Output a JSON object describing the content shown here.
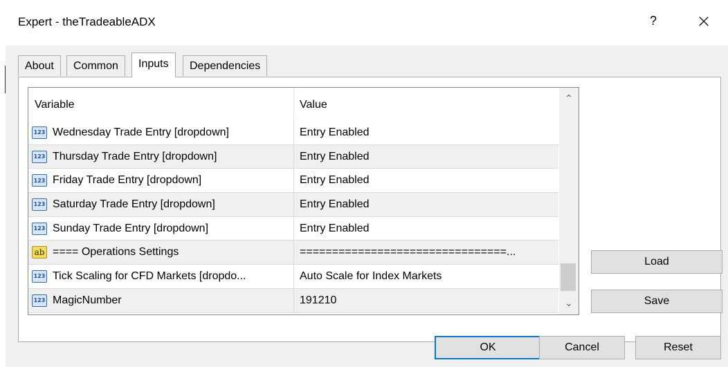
{
  "window": {
    "title": "Expert - theTradeableADX",
    "help_label": "?",
    "close_label": "×"
  },
  "tabs": [
    {
      "label": "About"
    },
    {
      "label": "Common"
    },
    {
      "label": "Inputs"
    },
    {
      "label": "Dependencies"
    }
  ],
  "active_tab": "Inputs",
  "grid": {
    "columns": {
      "variable": "Variable",
      "value": "Value"
    },
    "rows": [
      {
        "icon": "number-icon",
        "icon_text": "123",
        "variable": "Wednesday Trade Entry [dropdown]",
        "value": "Entry Enabled"
      },
      {
        "icon": "number-icon",
        "icon_text": "123",
        "variable": "Thursday Trade Entry [dropdown]",
        "value": "Entry Enabled"
      },
      {
        "icon": "number-icon",
        "icon_text": "123",
        "variable": "Friday Trade Entry [dropdown]",
        "value": "Entry Enabled"
      },
      {
        "icon": "number-icon",
        "icon_text": "123",
        "variable": "Saturday Trade Entry [dropdown]",
        "value": "Entry Enabled"
      },
      {
        "icon": "number-icon",
        "icon_text": "123",
        "variable": "Sunday Trade Entry [dropdown]",
        "value": "Entry Enabled"
      },
      {
        "icon": "string-icon",
        "icon_text": "ab",
        "variable": "==== Operations Settings",
        "value": "================================..."
      },
      {
        "icon": "number-icon",
        "icon_text": "123",
        "variable": "Tick Scaling for CFD Markets [dropdo...",
        "value": "Auto Scale for Index Markets"
      },
      {
        "icon": "number-icon",
        "icon_text": "123",
        "variable": "MagicNumber",
        "value": "191210"
      }
    ],
    "scroll_up": "⌃",
    "scroll_down": "⌄"
  },
  "side_buttons": {
    "load": "Load",
    "save": "Save"
  },
  "footer_buttons": {
    "ok": "OK",
    "cancel": "Cancel",
    "reset": "Reset"
  }
}
